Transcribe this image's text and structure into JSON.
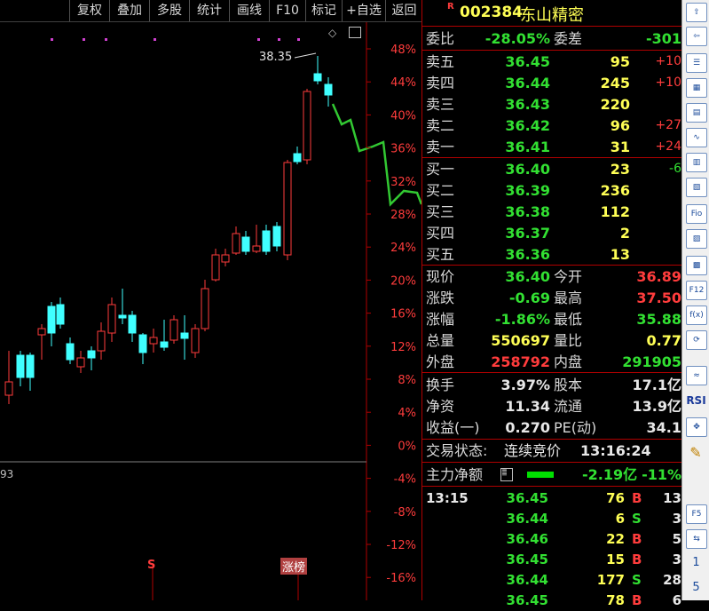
{
  "toolbar": {
    "buttons": [
      "复权",
      "叠加",
      "多股",
      "统计",
      "画线",
      "F10",
      "标记",
      "+自选",
      "返回"
    ]
  },
  "chart": {
    "price_annotation": "38.35",
    "left_label": "93",
    "markers": {
      "s_marker": "S",
      "zhangbang": "涨榜"
    },
    "axis_labels": [
      "48%",
      "44%",
      "40%",
      "36%",
      "32%",
      "28%",
      "24%",
      "20%",
      "16%",
      "12%",
      "8%",
      "4%",
      "0%",
      "-4%",
      "-8%",
      "-12%",
      "-16%"
    ],
    "colors": {
      "up": "#ff3c3c",
      "down": "#40ffff",
      "line": "#32c832",
      "axis": "#ff3c3c"
    }
  },
  "stock": {
    "badge": "R",
    "code": "002384",
    "name": "东山精密"
  },
  "ratio": {
    "weibi_label": "委比",
    "weibi_value": "-28.05%",
    "weicha_label": "委差",
    "weicha_value": "-301"
  },
  "asks": [
    {
      "label": "卖五",
      "price": "36.45",
      "vol": "95",
      "chg": "+10"
    },
    {
      "label": "卖四",
      "price": "36.44",
      "vol": "245",
      "chg": "+10"
    },
    {
      "label": "卖三",
      "price": "36.43",
      "vol": "220",
      "chg": ""
    },
    {
      "label": "卖二",
      "price": "36.42",
      "vol": "96",
      "chg": "+27"
    },
    {
      "label": "卖一",
      "price": "36.41",
      "vol": "31",
      "chg": "+24"
    }
  ],
  "bids": [
    {
      "label": "买一",
      "price": "36.40",
      "vol": "23",
      "chg": "-6"
    },
    {
      "label": "买二",
      "price": "36.39",
      "vol": "236",
      "chg": ""
    },
    {
      "label": "买三",
      "price": "36.38",
      "vol": "112",
      "chg": ""
    },
    {
      "label": "买四",
      "price": "36.37",
      "vol": "2",
      "chg": ""
    },
    {
      "label": "买五",
      "price": "36.36",
      "vol": "13",
      "chg": ""
    }
  ],
  "quote": [
    {
      "l1": "现价",
      "v1": "36.40",
      "c1": "green",
      "l2": "今开",
      "v2": "36.89",
      "c2": "red"
    },
    {
      "l1": "涨跌",
      "v1": "-0.69",
      "c1": "green",
      "l2": "最高",
      "v2": "37.50",
      "c2": "red"
    },
    {
      "l1": "涨幅",
      "v1": "-1.86%",
      "c1": "green",
      "l2": "最低",
      "v2": "35.88",
      "c2": "green"
    },
    {
      "l1": "总量",
      "v1": "550697",
      "c1": "yellow",
      "l2": "量比",
      "v2": "0.77",
      "c2": "yellow"
    },
    {
      "l1": "外盘",
      "v1": "258792",
      "c1": "red",
      "l2": "内盘",
      "v2": "291905",
      "c2": "green"
    }
  ],
  "fundamentals": [
    {
      "l1": "换手",
      "v1": "3.97%",
      "l2": "股本",
      "v2": "17.1亿"
    },
    {
      "l1": "净资",
      "v1": "11.34",
      "l2": "流通",
      "v2": "13.9亿"
    },
    {
      "l1": "收益(一)",
      "v1": "0.270",
      "l2": "PE(动)",
      "v2": "34.1"
    }
  ],
  "status": {
    "label": "交易状态:",
    "value": "连续竞价",
    "time": "13:16:24"
  },
  "main_flow": {
    "label": "主力净额",
    "value": "-2.19亿",
    "pct": "-11%"
  },
  "trades": [
    {
      "time": "13:15",
      "price": "36.45",
      "vol": "76",
      "side": "B",
      "count": "13"
    },
    {
      "time": "",
      "price": "36.44",
      "vol": "6",
      "side": "S",
      "count": "3"
    },
    {
      "time": "",
      "price": "36.46",
      "vol": "22",
      "side": "B",
      "count": "5"
    },
    {
      "time": "",
      "price": "36.45",
      "vol": "15",
      "side": "B",
      "count": "3"
    },
    {
      "time": "",
      "price": "36.44",
      "vol": "177",
      "side": "S",
      "count": "28"
    },
    {
      "time": "",
      "price": "36.45",
      "vol": "78",
      "side": "B",
      "count": "6"
    }
  ],
  "sidebar": {
    "labels": [
      "RSI",
      "F5",
      "1",
      "5"
    ]
  }
}
